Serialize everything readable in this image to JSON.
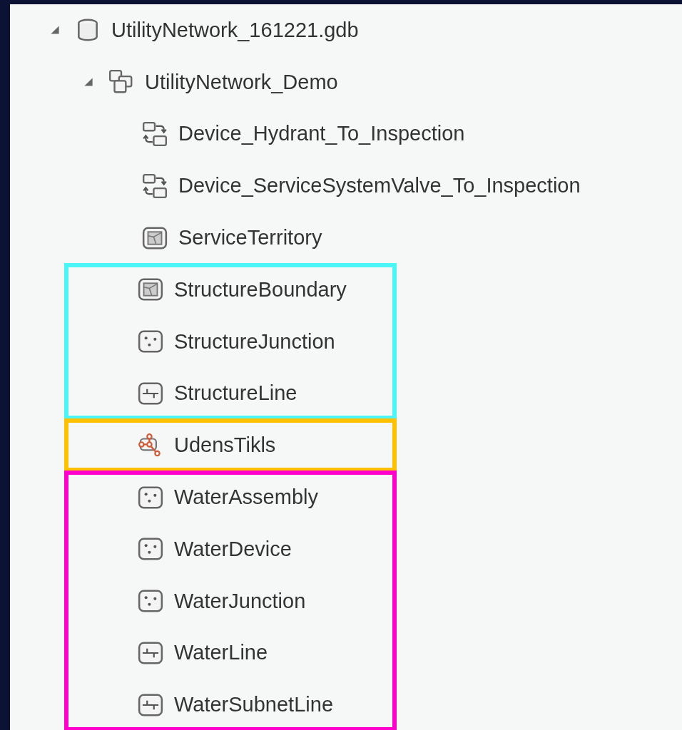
{
  "tree": [
    {
      "kind": "database",
      "label": "UtilityNetwork_161221.gdb",
      "expanded": true,
      "children": [
        {
          "kind": "dataset",
          "label": "UtilityNetwork_Demo",
          "expanded": true,
          "children": [
            {
              "kind": "relationship",
              "label": "Device_Hydrant_To_Inspection"
            },
            {
              "kind": "relationship",
              "label": "Device_ServiceSystemValve_To_Inspection"
            },
            {
              "kind": "polygon",
              "label": "ServiceTerritory"
            },
            {
              "kind": "highlight",
              "color": "#4df6f6",
              "children": [
                {
                  "kind": "polygon",
                  "label": "StructureBoundary"
                },
                {
                  "kind": "point",
                  "label": "StructureJunction"
                },
                {
                  "kind": "line",
                  "label": "StructureLine"
                }
              ]
            },
            {
              "kind": "highlight",
              "color": "#ffc000",
              "children": [
                {
                  "kind": "network",
                  "label": "UdensTikls"
                }
              ]
            },
            {
              "kind": "highlight",
              "color": "#ff00cc",
              "children": [
                {
                  "kind": "point",
                  "label": "WaterAssembly"
                },
                {
                  "kind": "point",
                  "label": "WaterDevice"
                },
                {
                  "kind": "point",
                  "label": "WaterJunction"
                },
                {
                  "kind": "line",
                  "label": "WaterLine"
                },
                {
                  "kind": "line",
                  "label": "WaterSubnetLine"
                }
              ]
            }
          ]
        }
      ]
    }
  ]
}
